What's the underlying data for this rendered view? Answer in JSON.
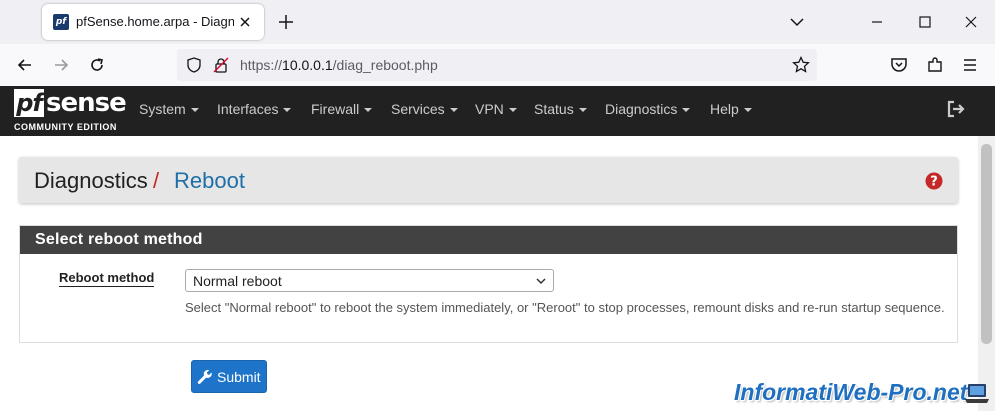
{
  "browser": {
    "tab_title": "pfSense.home.arpa - Diagnostics: Reboot",
    "favicon_text": "pf",
    "url_prefix": "https://",
    "url_host": "10.0.0.1",
    "url_path": "/diag_reboot.php"
  },
  "header": {
    "logo_pf": "pf",
    "logo_sense": "sense",
    "logo_edition": "COMMUNITY EDITION",
    "menu": [
      "System",
      "Interfaces",
      "Firewall",
      "Services",
      "VPN",
      "Status",
      "Diagnostics",
      "Help"
    ]
  },
  "breadcrumb": {
    "section": "Diagnostics",
    "separator": "/",
    "page": "Reboot"
  },
  "panel": {
    "title": "Select reboot method",
    "field_label": "Reboot method",
    "selected_value": "Normal reboot",
    "help_text": "Select \"Normal reboot\" to reboot the system immediately, or \"Reroot\" to stop processes, remount disks and re-run startup sequence."
  },
  "submit": {
    "label": "Submit"
  },
  "watermark": {
    "text": "InformatiWeb-Pro.net"
  },
  "colors": {
    "header_bg": "#212121",
    "panel_head_bg": "#424242",
    "accent_blue": "#1e74c8",
    "separator_red": "#c62828"
  },
  "icons": [
    "favicon-pf-icon",
    "close-icon",
    "plus-icon",
    "chevron-down-icon",
    "minimize-icon",
    "maximize-icon",
    "window-close-icon",
    "back-icon",
    "forward-icon",
    "reload-icon",
    "shield-icon",
    "lock-icon",
    "star-icon",
    "pocket-icon",
    "extensions-icon",
    "hamburger-icon",
    "logout-icon",
    "help-icon",
    "wrench-icon"
  ]
}
